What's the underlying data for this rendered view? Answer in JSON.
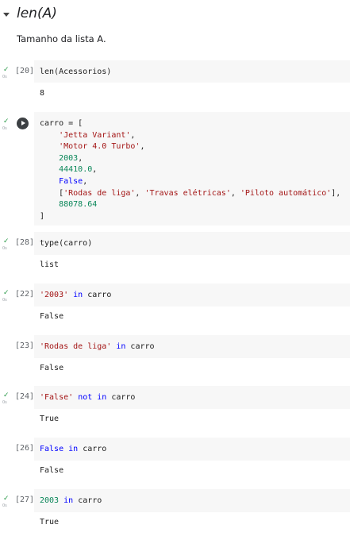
{
  "section": {
    "title": "len(A)",
    "text": "Tamanho da lista A."
  },
  "status": {
    "check": "✓",
    "time": "0s"
  },
  "cells": {
    "c20": {
      "count": "[20]",
      "code": "len(Acessorios)",
      "output": "8"
    },
    "c_def": {
      "l1": "carro = [",
      "l2": "'Jetta Variant'",
      "l3": "'Motor 4.0 Turbo'",
      "l4": "2003",
      "l5": "44410.0",
      "l6": "False",
      "l7a": "'Rodas de liga'",
      "l7b": "'Travas elétricas'",
      "l7c": "'Piloto automático'",
      "l8": "88078.64",
      "l9": "]"
    },
    "c28": {
      "count": "[28]",
      "code": "type(carro)",
      "output": "list"
    },
    "c22": {
      "count": "[22]",
      "str": "'2003'",
      "kw": "in",
      "var": "carro",
      "output": "False"
    },
    "c23": {
      "count": "[23]",
      "str": "'Rodas de liga'",
      "kw": "in",
      "var": "carro",
      "output": "False"
    },
    "c24": {
      "count": "[24]",
      "str": "'False'",
      "kw": "not in",
      "var": "carro",
      "output": "True"
    },
    "c26": {
      "count": "[26]",
      "kw1": "False",
      "kw": "in",
      "var": "carro",
      "output": "False"
    },
    "c27": {
      "count": "[27]",
      "num": "2003",
      "kw": "in",
      "var": "carro",
      "output": "True"
    }
  },
  "colors": {
    "string": "#a31515",
    "number": "#098658",
    "keyword": "#0000ff",
    "check": "#2e9b4c"
  }
}
